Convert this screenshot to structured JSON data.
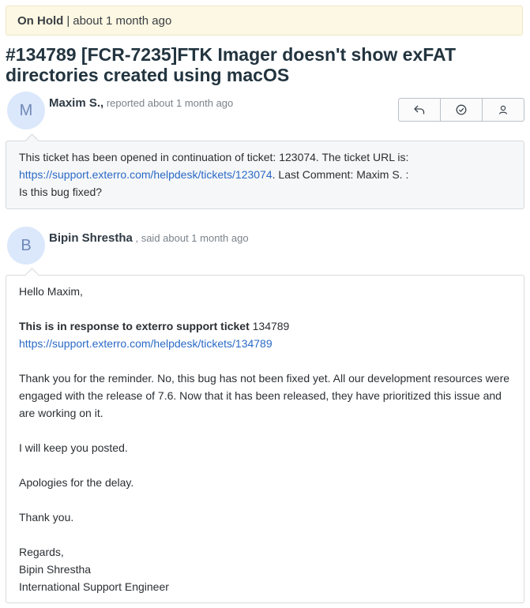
{
  "status": {
    "label": "On Hold",
    "separator": "|",
    "time": "about 1 month ago"
  },
  "ticket": {
    "title": "#134789 [FCR-7235]FTK Imager doesn't show exFAT directories created using macOS"
  },
  "post1": {
    "avatar_letter": "M",
    "author": "Maxim S.,",
    "action": " reported about 1 month ago",
    "line1": "This ticket has been opened in continuation of ticket: 123074. The ticket URL is:",
    "link": "https://support.exterro.com/helpdesk/tickets/123074",
    "line2_suffix": ". Last Comment: Maxim S. :",
    "line3": "Is this bug fixed?"
  },
  "actions": {
    "icons": [
      "reply-icon",
      "resolve-check-icon",
      "assign-user-icon"
    ]
  },
  "post2": {
    "avatar_letter": "B",
    "author": "Bipin Shrestha",
    "action": " , said about 1 month ago",
    "greeting": "Hello Maxim,",
    "response_bold": "This is in response to exterro support ticket",
    "response_number": " 134789",
    "link": "https://support.exterro.com/helpdesk/tickets/134789",
    "para1": "Thank you for the reminder. No, this bug has not been fixed yet. All our development resources were engaged with the release of 7.6. Now that it has been released, they have prioritized this issue and are working on it.",
    "para2": "I will keep you posted.",
    "para3": "Apologies for the delay.",
    "para4": "Thank you.",
    "sign1": "Regards,",
    "sign2": "Bipin Shrestha",
    "sign3": "International Support Engineer"
  }
}
